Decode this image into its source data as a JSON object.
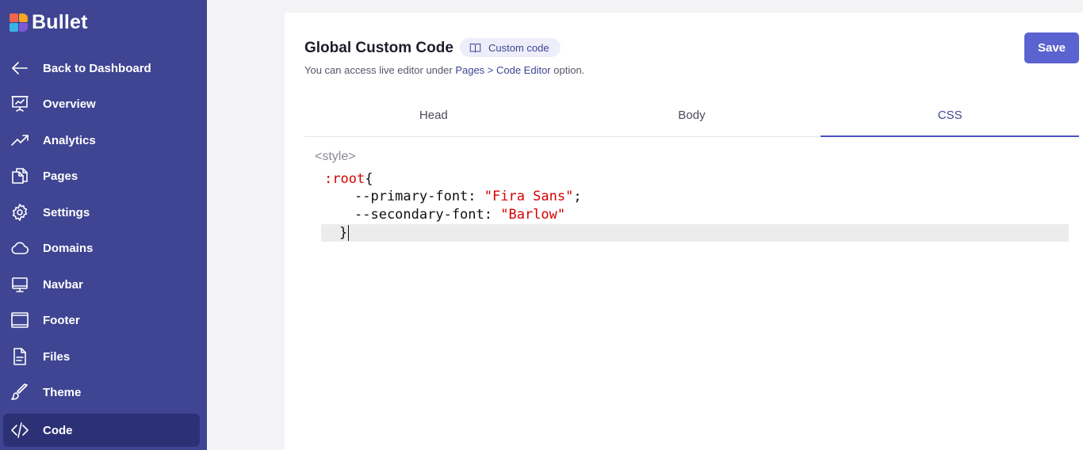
{
  "app": {
    "logo_text": "Bullet"
  },
  "sidebar": {
    "items": [
      {
        "label": "Back to Dashboard",
        "icon": "arrow-left-icon"
      },
      {
        "label": "Overview",
        "icon": "presentation-chart-icon"
      },
      {
        "label": "Analytics",
        "icon": "trending-up-icon"
      },
      {
        "label": "Pages",
        "icon": "pages-icon"
      },
      {
        "label": "Settings",
        "icon": "gear-icon"
      },
      {
        "label": "Domains",
        "icon": "cloud-icon"
      },
      {
        "label": "Navbar",
        "icon": "monitor-icon"
      },
      {
        "label": "Footer",
        "icon": "footer-layout-icon"
      },
      {
        "label": "Files",
        "icon": "file-icon"
      },
      {
        "label": "Theme",
        "icon": "brush-icon"
      },
      {
        "label": "Code",
        "icon": "code-icon",
        "active": true
      }
    ]
  },
  "main": {
    "title": "Global Custom Code",
    "badge_label": "Custom code",
    "badge_icon": "book-icon",
    "subtitle_prefix": "You can access live editor under ",
    "subtitle_link": "Pages > Code Editor",
    "subtitle_suffix": " option.",
    "save_label": "Save",
    "tabs": [
      {
        "label": "Head"
      },
      {
        "label": "Body"
      },
      {
        "label": "CSS",
        "active": true
      }
    ],
    "editor": {
      "line0": "<style>",
      "line1_selector": ":root",
      "line1_brace": "{",
      "line2_prop": "--primary-font: ",
      "line2_value": "\"Fira Sans\"",
      "line2_end": ";",
      "line3_prop": "--secondary-font: ",
      "line3_value": "\"Barlow\"",
      "line4": "}"
    }
  },
  "colors": {
    "sidebar_bg": "#3f4592",
    "sidebar_active": "#2c3176",
    "accent": "#5a63cf",
    "code_string": "#d40000"
  }
}
